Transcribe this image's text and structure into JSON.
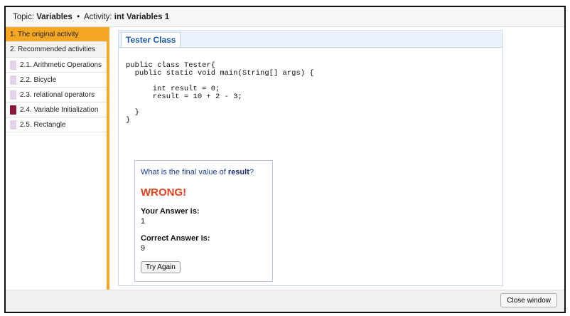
{
  "topbar": {
    "topic_label": "Topic:",
    "topic_value": "Variables",
    "separator": "•",
    "activity_label": "Activity:",
    "activity_value": "int Variables 1"
  },
  "sidebar": {
    "items": [
      {
        "label": "1. The original activity",
        "state": "active"
      },
      {
        "label": "2. Recommended activities",
        "state": "header"
      },
      {
        "label": "2.1. Arithmetic Operations",
        "swatch": "#e3d2ea"
      },
      {
        "label": "2.2. Bicycle",
        "swatch": "#e3d2ea"
      },
      {
        "label": "2.3. relational operators",
        "swatch": "#e3d2ea"
      },
      {
        "label": "2.4. Variable Initialization",
        "swatch": "#8b1a3a"
      },
      {
        "label": "2.5. Rectangle",
        "swatch": "#e3d2ea"
      }
    ]
  },
  "main": {
    "tab_label": "Tester Class",
    "code": "public class Tester{\n  public static void main(String[] args) {\n\n      int result = 0;\n      result = 10 + 2 - 3;\n\n  }\n}",
    "question": {
      "prefix": "What is the final value of ",
      "variable": "result",
      "suffix": "?",
      "verdict": "WRONG!",
      "your_answer_label": "Your Answer is:",
      "your_answer_value": "1",
      "correct_answer_label": "Correct Answer is:",
      "correct_answer_value": "9",
      "try_again_label": "Try Again"
    }
  },
  "footer": {
    "close_label": "Close window"
  },
  "colors": {
    "accent": "#f5a623",
    "wrong": "#e4401c",
    "link_blue": "#1a56a8"
  }
}
